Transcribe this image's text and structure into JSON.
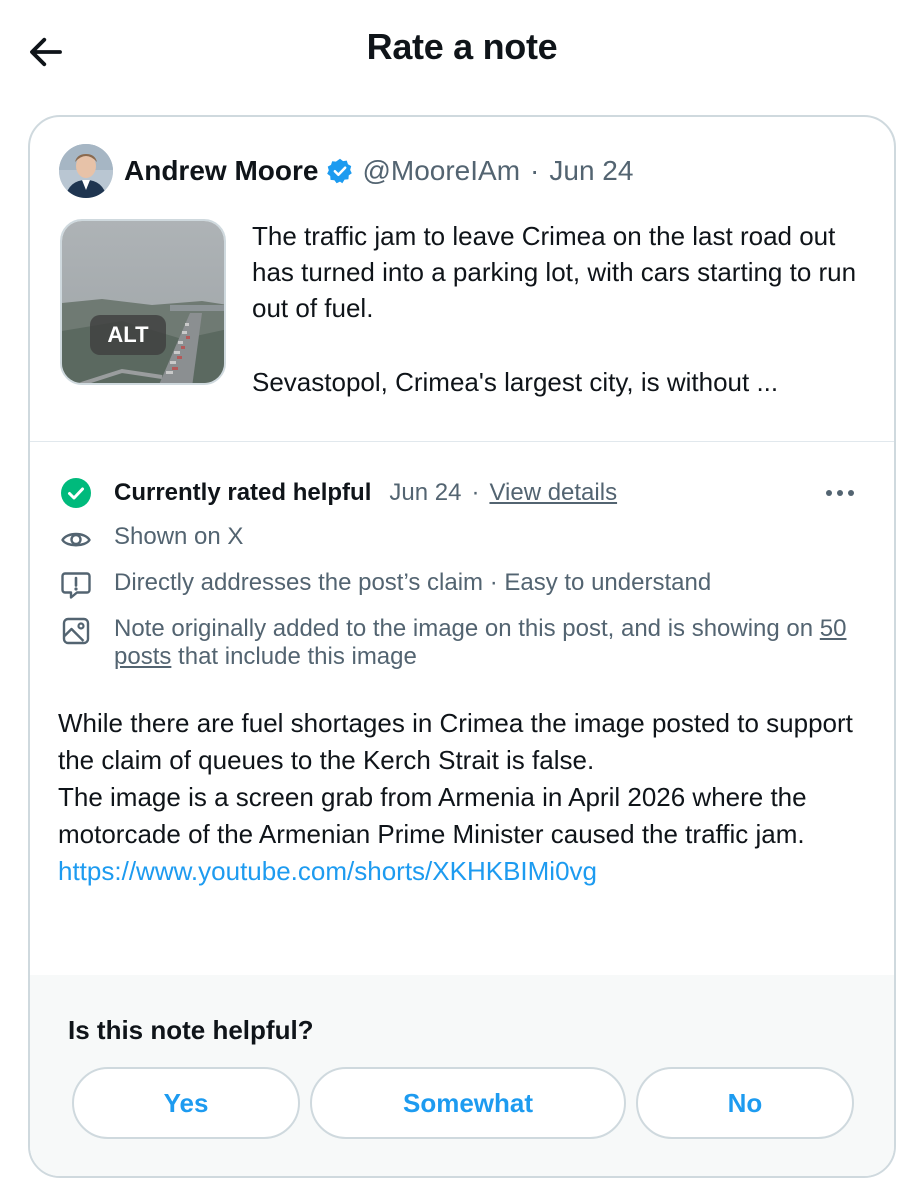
{
  "header": {
    "title": "Rate a note",
    "back_icon": "arrow-left-icon"
  },
  "post": {
    "author_name": "Andrew Moore",
    "verified_icon": "verified-badge-icon",
    "handle": "@MooreIAm",
    "separator": "·",
    "date": "Jun 24",
    "media_alt_badge": "ALT",
    "text_paragraph_1": "The traffic jam to leave Crimea on the last road out has turned into a parking lot, with cars starting to run out of fuel.",
    "text_paragraph_2": "Sevastopol, Crimea's largest city, is without ..."
  },
  "note": {
    "status_label": "Currently rated helpful",
    "status_date": "Jun 24",
    "status_separator": "·",
    "view_details": "View details",
    "shown_on": "Shown on X",
    "reasons": "Directly addresses the post’s claim · Easy to understand",
    "media_note_prefix": "Note originally added to the image on this post, and is showing on",
    "media_note_link": "50 posts",
    "media_note_suffix": "that include this image",
    "body_line_1": "While there are fuel shortages in Crimea the image posted to support the claim of queues to the Kerch Strait is false.",
    "body_line_2": "The image is a screen grab from Armenia in April 2026 where the motorcade of the Armenian Prime Minister caused the traffic jam.",
    "link": "https://www.youtube.com/shorts/XKHKBIMi0vg"
  },
  "rating": {
    "question": "Is this note helpful?",
    "options": [
      "Yes",
      "Somewhat",
      "No"
    ]
  },
  "colors": {
    "accent": "#1d9bf0",
    "helpful_green": "#00ba7c",
    "muted_text": "#536471",
    "border": "#cfd9de"
  }
}
